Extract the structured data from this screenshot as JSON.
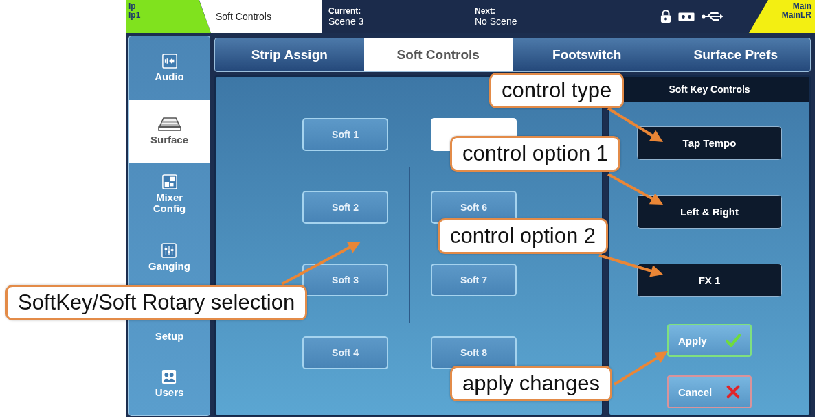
{
  "status_bar": {
    "input": {
      "lines": [
        "Ip",
        "Ip1"
      ]
    },
    "screen_title": "Soft Controls",
    "current": {
      "label": "Current:",
      "value": "Scene 3"
    },
    "next": {
      "label": "Next:",
      "value": "No Scene"
    },
    "output": {
      "lines": [
        "Main",
        "MainLR"
      ]
    }
  },
  "sidebar": {
    "items": [
      {
        "label": "Audio",
        "selected": false
      },
      {
        "label": "Surface",
        "selected": true
      },
      {
        "label": "Mixer Config",
        "selected": false
      },
      {
        "label": "Ganging",
        "selected": false
      },
      {
        "label": "Setup",
        "selected": false
      },
      {
        "label": "Users",
        "selected": false
      }
    ]
  },
  "tabs": [
    {
      "label": "Strip Assign",
      "selected": false
    },
    {
      "label": "Soft Controls",
      "selected": true
    },
    {
      "label": "Footswitch",
      "selected": false
    },
    {
      "label": "Surface Prefs",
      "selected": false
    }
  ],
  "soft_keys": [
    {
      "label": "Soft 1",
      "selected": false
    },
    {
      "label": "Soft 2",
      "selected": false
    },
    {
      "label": "Soft 3",
      "selected": false
    },
    {
      "label": "Soft 4",
      "selected": false
    },
    {
      "selected": true
    },
    {
      "label": "Soft 6",
      "selected": false
    },
    {
      "label": "Soft 7",
      "selected": false
    },
    {
      "label": "Soft 8",
      "selected": false
    }
  ],
  "soft_key_controls": {
    "title": "Soft Key Controls",
    "fields": [
      {
        "value": "Tap Tempo"
      },
      {
        "value": "Left & Right"
      },
      {
        "value": "FX 1"
      }
    ],
    "buttons": [
      {
        "label": "Apply",
        "kind": "apply"
      },
      {
        "label": "Cancel",
        "kind": "cancel"
      }
    ]
  },
  "annotations": [
    {
      "text": "control type"
    },
    {
      "text": "control option 1"
    },
    {
      "text": "control option 2"
    },
    {
      "text": "SoftKey/Soft Rotary selection"
    },
    {
      "text": "apply changes"
    }
  ]
}
